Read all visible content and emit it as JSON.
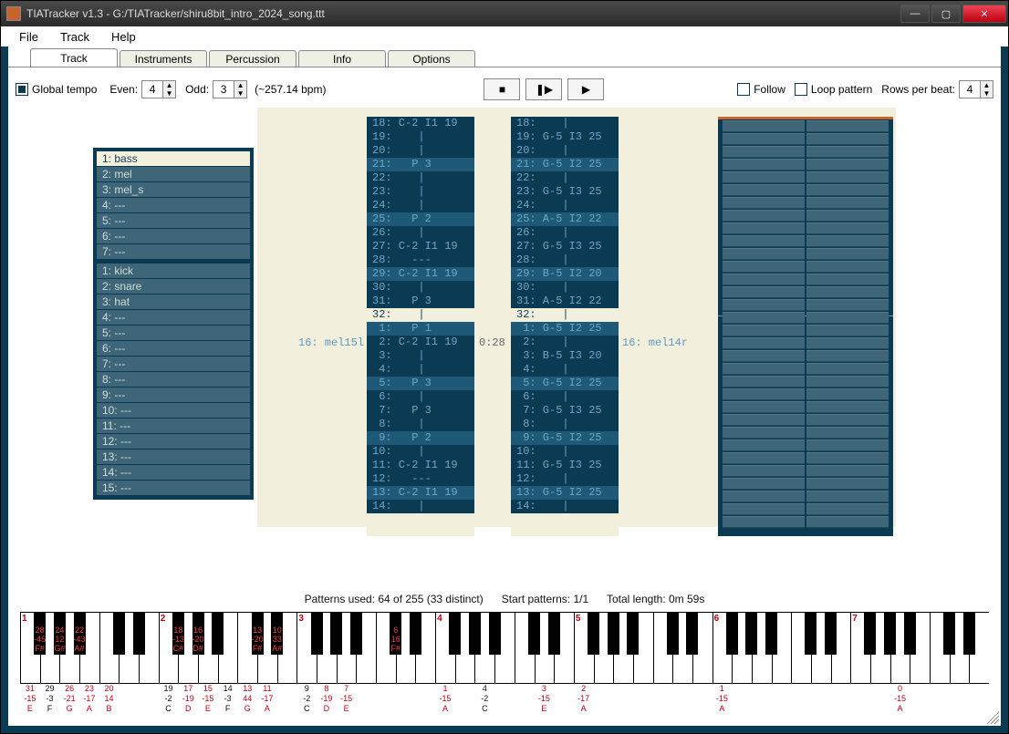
{
  "window": {
    "title": "TIATracker v1.3 - G:/TIATracker/shiru8bit_intro_2024_song.ttt"
  },
  "menu": {
    "file": "File",
    "track": "Track",
    "help": "Help"
  },
  "tabs": {
    "track": "Track",
    "instruments": "Instruments",
    "percussion": "Percussion",
    "info": "Info",
    "options": "Options"
  },
  "opts": {
    "global_tempo_label": "Global tempo",
    "even_label": "Even:",
    "even_value": "4",
    "odd_label": "Odd:",
    "odd_value": "3",
    "bpm_text": "(~257.14 bpm)",
    "follow_label": "Follow",
    "loop_label": "Loop pattern",
    "rows_label": "Rows per beat:",
    "rows_value": "4"
  },
  "transport": {
    "stop": "■",
    "step": "❚▶",
    "play": "▶"
  },
  "instruments": [
    "1: bass",
    "2: mel",
    "3: mel_s",
    "4: ---",
    "5: ---",
    "6: ---",
    "7: ---"
  ],
  "percussion": [
    "1: kick",
    "2: snare",
    "3: hat",
    "4: ---",
    "5: ---",
    "6: ---",
    "7: ---",
    "8: ---",
    "9: ---",
    "10: ---",
    "11: ---",
    "12: ---",
    "13: ---",
    "14: ---",
    "15: ---"
  ],
  "selected_instrument_index": 0,
  "patternLabelLeft": "16: mel15l",
  "patternLabelRight": "16: mel14r",
  "timestamp": "0:28",
  "leftColumn": [
    {
      "t": "18: C-2 I1 19",
      "hl": false
    },
    {
      "t": "19:    |     ",
      "hl": false
    },
    {
      "t": "20:    |     ",
      "hl": false
    },
    {
      "t": "21:   P 3    ",
      "hl": true
    },
    {
      "t": "22:    |     ",
      "hl": false
    },
    {
      "t": "23:    |     ",
      "hl": false
    },
    {
      "t": "24:    |     ",
      "hl": false
    },
    {
      "t": "25:   P 2    ",
      "hl": true
    },
    {
      "t": "26:    |     ",
      "hl": false
    },
    {
      "t": "27: C-2 I1 19",
      "hl": false
    },
    {
      "t": "28:   ---    ",
      "hl": false
    },
    {
      "t": "29: C-2 I1 19",
      "hl": true
    },
    {
      "t": "30:    |     ",
      "hl": false
    },
    {
      "t": "31:   P 3    ",
      "hl": false
    },
    {
      "t": "32:    |     ",
      "hl": false,
      "cursor": true
    },
    {
      "t": " 1:   P 1    ",
      "hl": true
    },
    {
      "t": " 2: C-2 I1 19",
      "hl": false
    },
    {
      "t": " 3:    |     ",
      "hl": false
    },
    {
      "t": " 4:    |     ",
      "hl": false
    },
    {
      "t": " 5:   P 3    ",
      "hl": true
    },
    {
      "t": " 6:    |     ",
      "hl": false
    },
    {
      "t": " 7:   P 3    ",
      "hl": false
    },
    {
      "t": " 8:    |     ",
      "hl": false
    },
    {
      "t": " 9:   P 2    ",
      "hl": true
    },
    {
      "t": "10:    |     ",
      "hl": false
    },
    {
      "t": "11: C-2 I1 19",
      "hl": false
    },
    {
      "t": "12:   ---    ",
      "hl": false
    },
    {
      "t": "13: C-2 I1 19",
      "hl": true
    },
    {
      "t": "14:    |     ",
      "hl": false
    }
  ],
  "rightColumn": [
    {
      "t": "18:    |     ",
      "hl": false
    },
    {
      "t": "19: G-5 I3 25",
      "hl": false
    },
    {
      "t": "20:    |     ",
      "hl": false
    },
    {
      "t": "21: G-5 I2 25",
      "hl": true
    },
    {
      "t": "22:    |     ",
      "hl": false
    },
    {
      "t": "23: G-5 I3 25",
      "hl": false
    },
    {
      "t": "24:    |     ",
      "hl": false
    },
    {
      "t": "25: A-5 I2 22",
      "hl": true
    },
    {
      "t": "26:    |     ",
      "hl": false
    },
    {
      "t": "27: G-5 I3 25",
      "hl": false
    },
    {
      "t": "28:    |     ",
      "hl": false
    },
    {
      "t": "29: B-5 I2 20",
      "hl": true
    },
    {
      "t": "30:    |     ",
      "hl": false
    },
    {
      "t": "31: A-5 I2 22",
      "hl": false
    },
    {
      "t": "32:    |     ",
      "hl": false,
      "cursor": true
    },
    {
      "t": " 1: G-5 I2 25",
      "hl": true
    },
    {
      "t": " 2:    |     ",
      "hl": false
    },
    {
      "t": " 3: B-5 I3 20",
      "hl": false
    },
    {
      "t": " 4:    |     ",
      "hl": false
    },
    {
      "t": " 5: G-5 I2 25",
      "hl": true
    },
    {
      "t": " 6:    |     ",
      "hl": false
    },
    {
      "t": " 7: G-5 I3 25",
      "hl": false
    },
    {
      "t": " 8:    |     ",
      "hl": false
    },
    {
      "t": " 9: G-5 I2 25",
      "hl": true
    },
    {
      "t": "10:    |     ",
      "hl": false
    },
    {
      "t": "11: G-5 I3 25",
      "hl": false
    },
    {
      "t": "12:    |     ",
      "hl": false
    },
    {
      "t": "13: G-5 I2 25",
      "hl": true
    },
    {
      "t": "14:    |     ",
      "hl": false
    }
  ],
  "status": {
    "patterns": "Patterns used: 64 of 255 (33 distinct)",
    "start": "Start patterns: 1/1",
    "length": "Total length: 0m 59s"
  },
  "piano": {
    "octave_numbers": [
      "1",
      "2",
      "3",
      "4",
      "5",
      "6",
      "7"
    ],
    "black_labels": [
      {
        "oct": 0,
        "pos": 0,
        "txt": "28\n-45\nF#",
        "red": true
      },
      {
        "oct": 0,
        "pos": 1,
        "txt": "24\n12\nG#",
        "red": true
      },
      {
        "oct": 0,
        "pos": 2,
        "txt": "22\n-43\nA#",
        "red": true
      },
      {
        "oct": 1,
        "pos": 0,
        "txt": "18\n-13\nC#",
        "red": true
      },
      {
        "oct": 1,
        "pos": 1,
        "txt": "16\n-20\nD#",
        "red": true
      },
      {
        "oct": 1,
        "pos": 3,
        "txt": "13\n-20\nF#",
        "red": true
      },
      {
        "oct": 1,
        "pos": 4,
        "txt": "10\n33\nA#",
        "red": true
      },
      {
        "oct": 2,
        "pos": 3,
        "txt": "6\n16\nF#",
        "red": true
      }
    ],
    "white_labels": [
      {
        "oct": 0,
        "i": 0,
        "txt": "31\n-15\nE",
        "red": true
      },
      {
        "oct": 0,
        "i": 1,
        "txt": "29\n-3\nF",
        "red": false
      },
      {
        "oct": 0,
        "i": 2,
        "txt": "26\n-21\nG",
        "red": true
      },
      {
        "oct": 0,
        "i": 3,
        "txt": "23\n-17\nA",
        "red": true
      },
      {
        "oct": 0,
        "i": 4,
        "txt": "20\n14\nB",
        "red": true
      },
      {
        "oct": 1,
        "i": 0,
        "txt": "19\n-2\nC",
        "red": false
      },
      {
        "oct": 1,
        "i": 1,
        "txt": "17\n-19\nD",
        "red": true
      },
      {
        "oct": 1,
        "i": 2,
        "txt": "15\n-15\nE",
        "red": true
      },
      {
        "oct": 1,
        "i": 3,
        "txt": "14\n-3\nF",
        "red": false
      },
      {
        "oct": 1,
        "i": 4,
        "txt": "13\n44\nG",
        "red": true
      },
      {
        "oct": 1,
        "i": 5,
        "txt": "11\n-17\nA",
        "red": true
      },
      {
        "oct": 2,
        "i": 0,
        "txt": "9\n-2\nC",
        "red": false
      },
      {
        "oct": 2,
        "i": 1,
        "txt": "8\n-19\nD",
        "red": true
      },
      {
        "oct": 2,
        "i": 2,
        "txt": "7\n-15\nE",
        "red": true
      },
      {
        "oct": 3,
        "i": 0,
        "txt": "1\n-15\nA",
        "red": true
      },
      {
        "oct": 3,
        "i": 2,
        "txt": "4\n-2\nC",
        "red": false
      },
      {
        "oct": 3,
        "i": 5,
        "txt": "3\n-15\nE",
        "red": true
      },
      {
        "oct": 4,
        "i": 0,
        "txt": "2\n-17\nA",
        "red": true
      },
      {
        "oct": 5,
        "i": 0,
        "txt": "1\n-15\nA",
        "red": true
      },
      {
        "oct": 6,
        "i": 2,
        "txt": "0\n-15\nA",
        "red": true
      }
    ]
  }
}
